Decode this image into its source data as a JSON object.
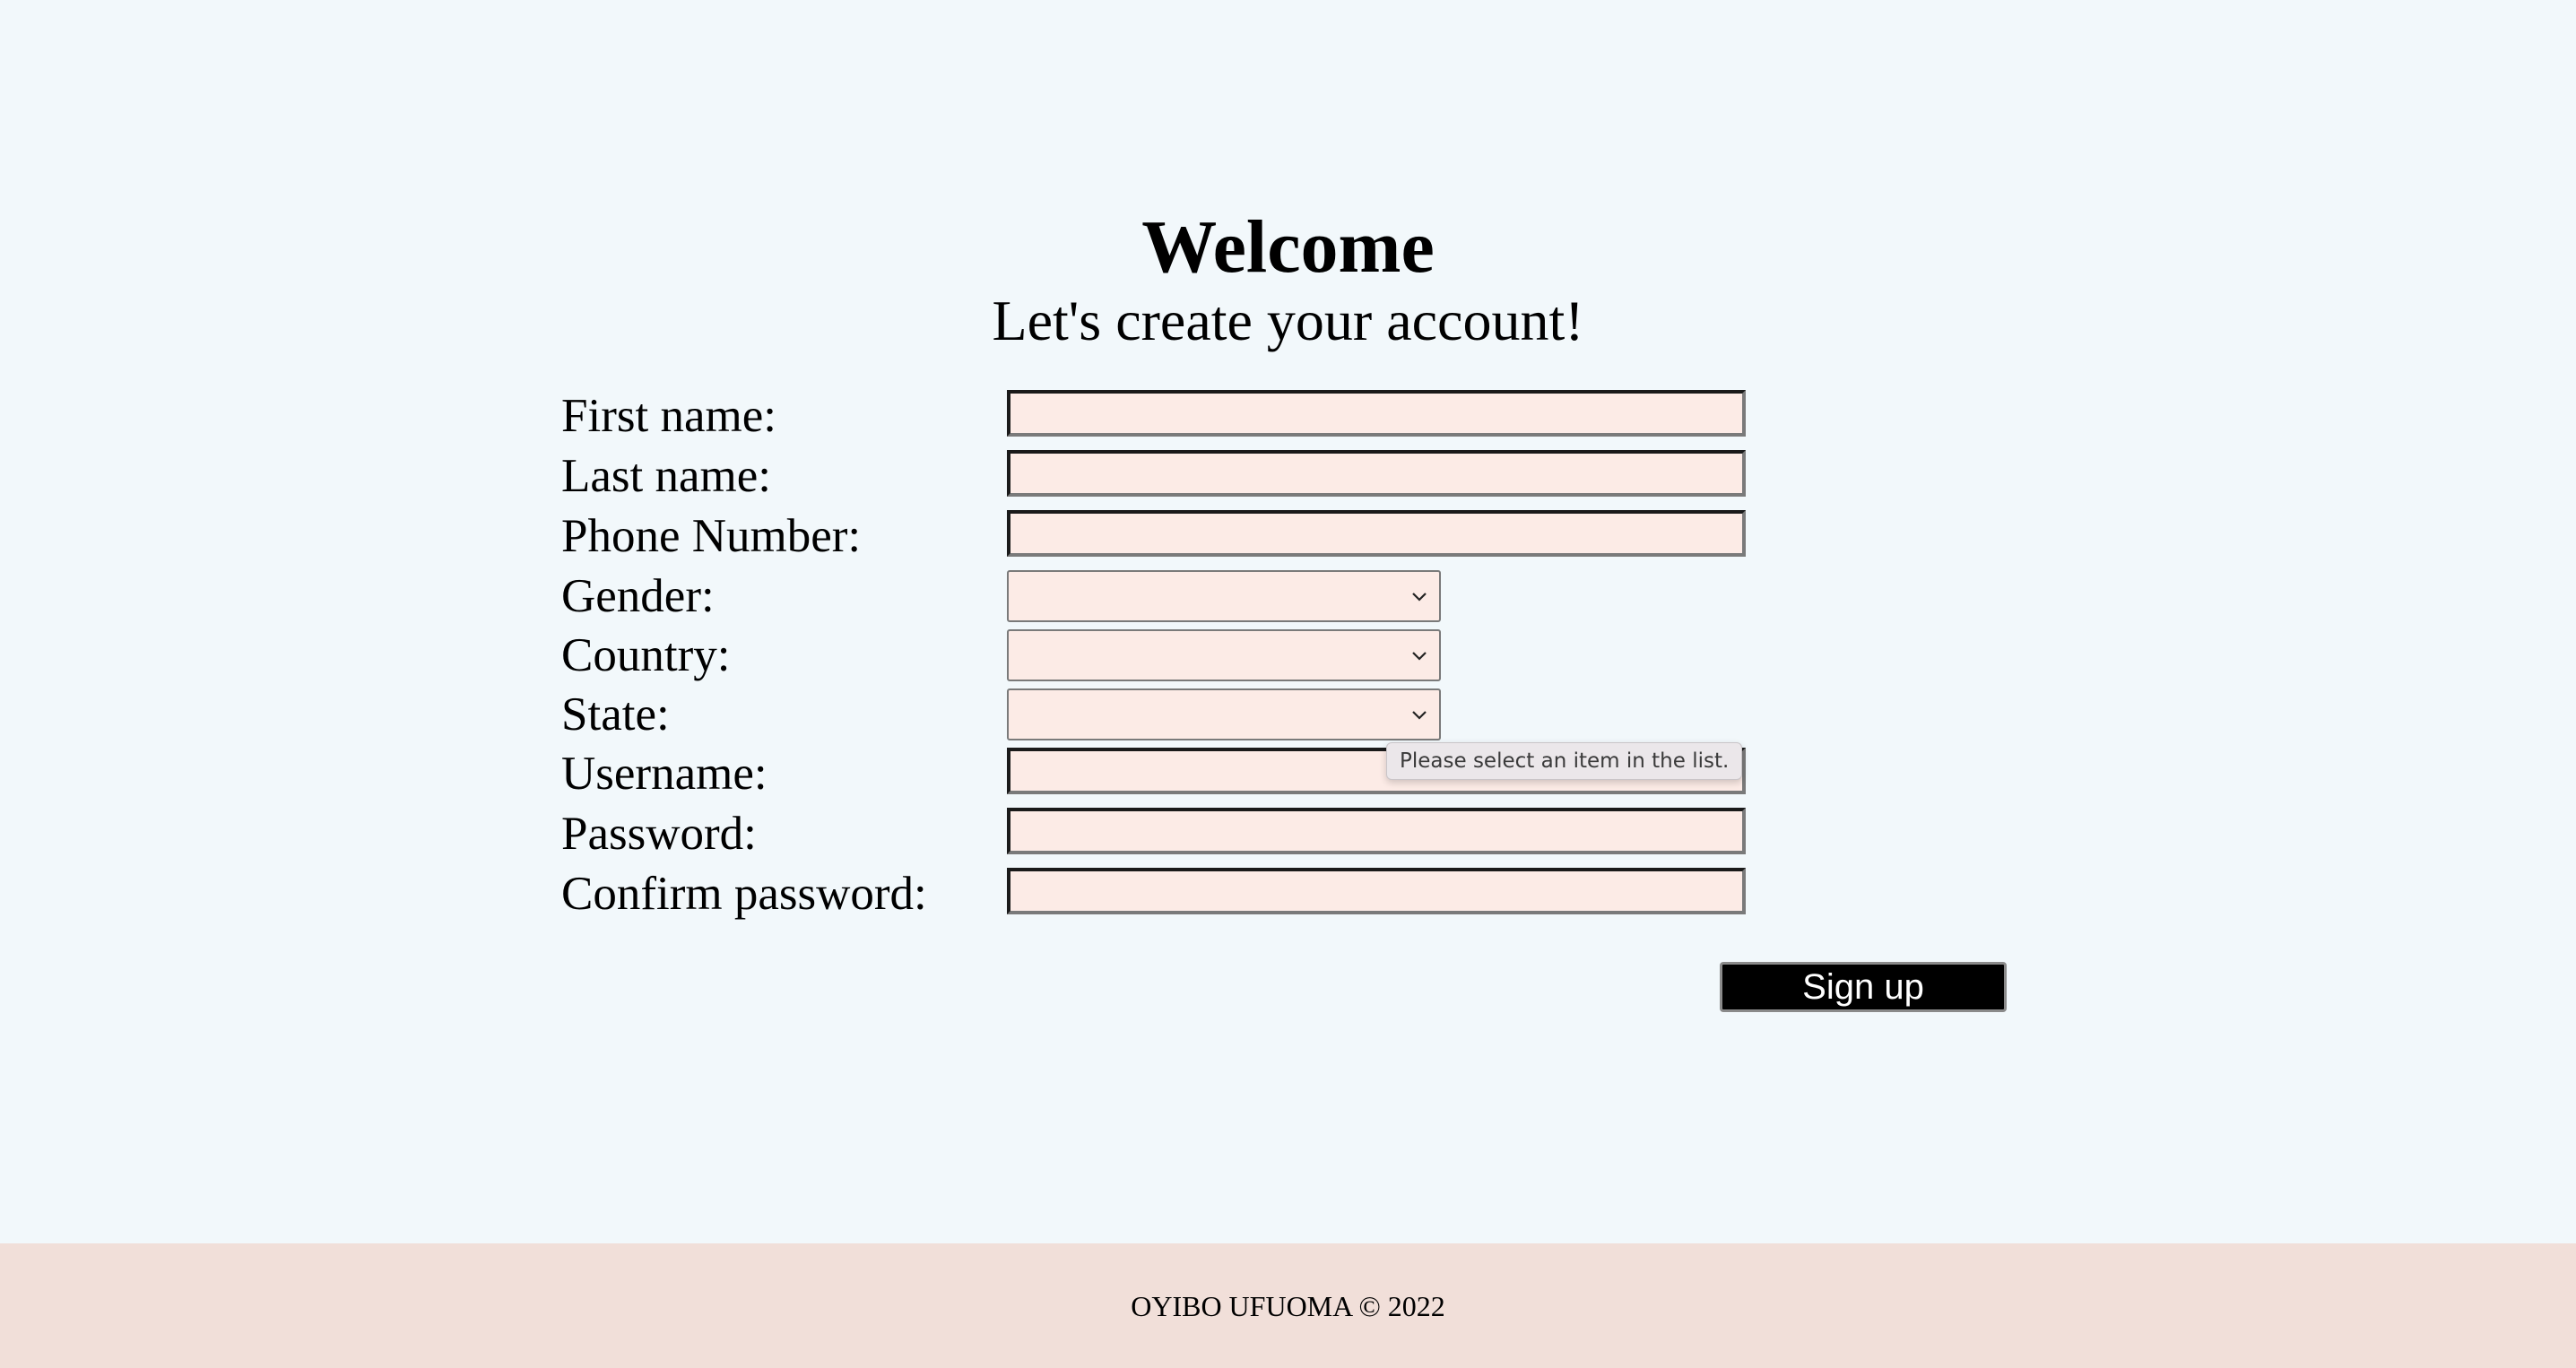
{
  "header": {
    "title": "Welcome",
    "subtitle": "Let's create your account!"
  },
  "form": {
    "fields": {
      "first_name": {
        "label": "First name:",
        "value": ""
      },
      "last_name": {
        "label": "Last name:",
        "value": ""
      },
      "phone_number": {
        "label": "Phone Number:",
        "value": ""
      },
      "gender": {
        "label": "Gender:",
        "selected": ""
      },
      "country": {
        "label": "Country:",
        "selected": ""
      },
      "state": {
        "label": "State:",
        "selected": ""
      },
      "username": {
        "label": "Username:",
        "value": ""
      },
      "password": {
        "label": "Password:",
        "value": ""
      },
      "confirm_password": {
        "label": "Confirm password:",
        "value": ""
      }
    },
    "validation_tooltip": "Please select an item in the list.",
    "submit_label": "Sign up"
  },
  "footer": {
    "text": "OYIBO UFUOMA © 2022"
  },
  "colors": {
    "page_background": "#f2f8fb",
    "input_background": "#fcebe6",
    "footer_background": "#f1dfd9",
    "button_background": "#000000",
    "button_text": "#ffffff"
  },
  "icons": {
    "select_chevron": "chevron-down-icon"
  }
}
